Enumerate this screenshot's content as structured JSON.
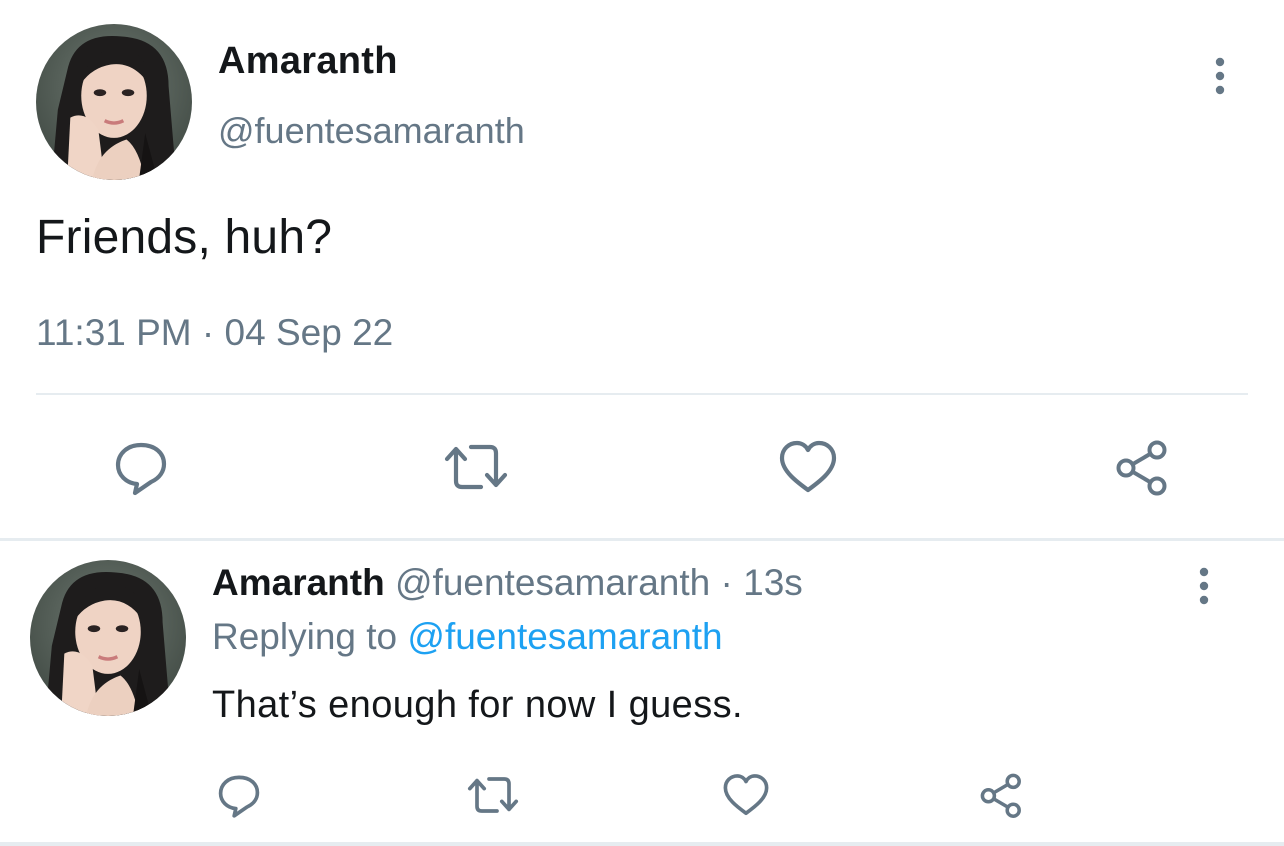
{
  "main_tweet": {
    "author_name": "Amaranth",
    "author_handle": "@fuentesamaranth",
    "text": "Friends, huh?",
    "time": "11:31 PM",
    "separator": "·",
    "date": "04 Sep 22",
    "actions": [
      "reply-icon",
      "retweet-icon",
      "like-icon",
      "share-icon"
    ],
    "more_icon": "more-vertical-icon"
  },
  "reply_tweet": {
    "author_name": "Amaranth",
    "author_handle": "@fuentesamaranth",
    "separator": "·",
    "relative_time": "13s",
    "replying_label": "Replying to",
    "replying_handle": "@fuentesamaranth",
    "text": "That’s enough for now I guess.",
    "actions": [
      "reply-icon",
      "retweet-icon",
      "like-icon",
      "share-icon"
    ],
    "more_icon": "more-vertical-icon"
  },
  "colors": {
    "text_primary": "#14171a",
    "text_secondary": "#657786",
    "link": "#1da1f2",
    "divider": "#e6ecf0",
    "icon": "#657786"
  }
}
